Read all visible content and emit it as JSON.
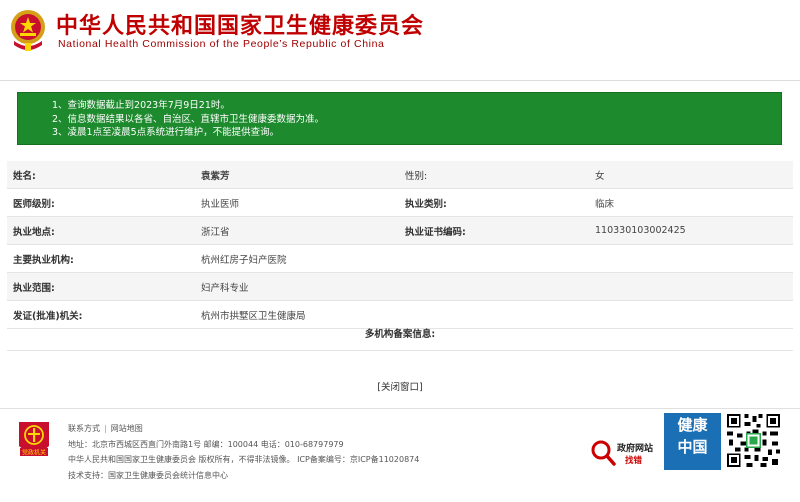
{
  "header": {
    "title_cn": "中华人民共和国国家卫生健康委员会",
    "title_en": "National Health Commission of the People’s Republic of China"
  },
  "notice": [
    "1、查询数据截止到2023年7月9日21时。",
    "2、信息数据结果以各省、自治区、直辖市卫生健康委数据为准。",
    "3、凌晨1点至凌晨5点系统进行维护，不能提供查询。"
  ],
  "record": {
    "name_label": "姓名:",
    "name_value": "袁紫芳",
    "gender_label": "性别:",
    "gender_value": "女",
    "level_label": "医师级别:",
    "level_value": "执业医师",
    "category_label": "执业类别:",
    "category_value": "临床",
    "location_label": "执业地点:",
    "location_value": "浙江省",
    "cert_label": "执业证书编码:",
    "cert_value": "110330103002425",
    "institution_label": "主要执业机构:",
    "institution_value": "杭州红房子妇产医院",
    "scope_label": "执业范围:",
    "scope_value": "妇产科专业",
    "issuer_label": "发证(批准)机关:",
    "issuer_value": "杭州市拱墅区卫生健康局",
    "multi_label": "多机构备案信息:"
  },
  "close_label": "[关闭窗口]",
  "footer": {
    "contact": "联系方式",
    "sitemap": "网站地图",
    "address": "地址：北京市西城区西直门外南路1号   邮编：100044   电话：010-68797979",
    "copyright": "中华人民共和国国家卫生健康委员会   版权所有，不得非法镜像。 ICP备案编号：京ICP备11020874",
    "support": "技术支持：国家卫生健康委员会统计信息中心",
    "gov_find_1": "政府网站",
    "gov_find_2": "找错",
    "health_china_1": "健康",
    "health_china_2": "中国",
    "badge_text": "党政机关"
  },
  "colors": {
    "brand_red": "#c00000",
    "notice_green": "#1e8a2e",
    "health_blue": "#1b6fb5"
  },
  "icons": [
    "national-emblem-icon",
    "party-gov-badge-icon",
    "search-magnifier-icon",
    "qr-code-icon"
  ]
}
